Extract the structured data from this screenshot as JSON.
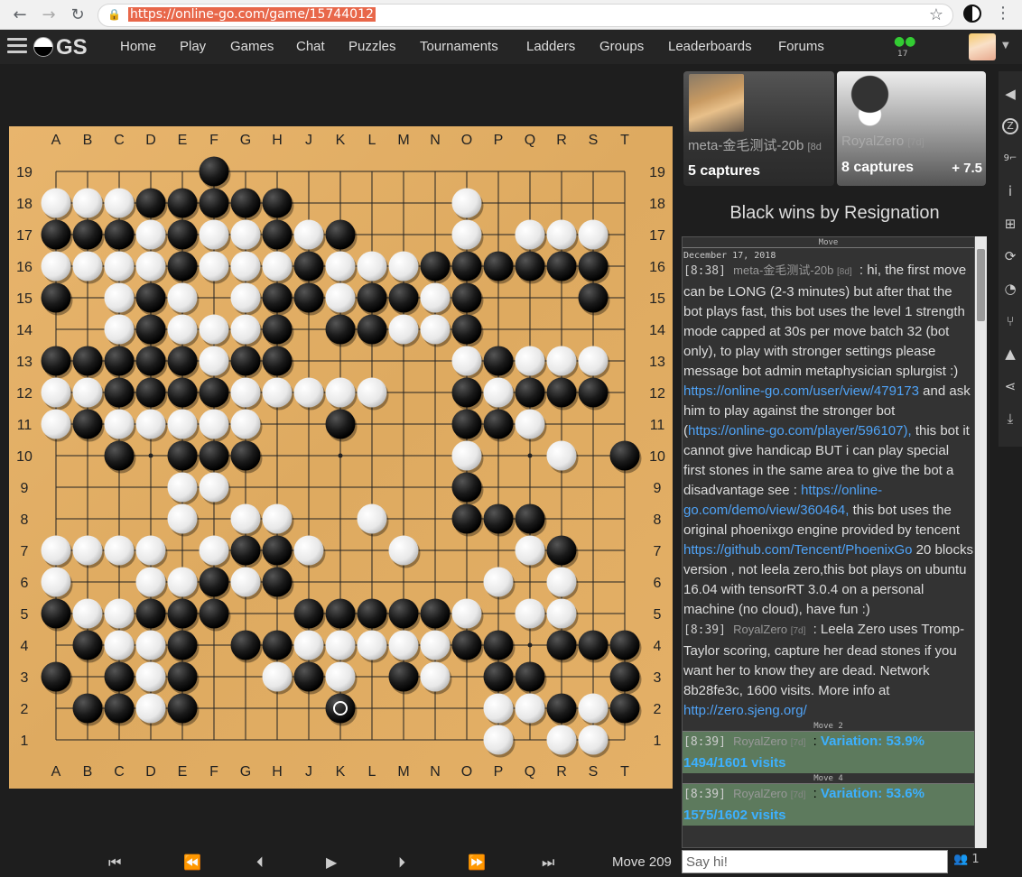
{
  "browser": {
    "url": "https://online-go.com/game/15744012",
    "back": "←",
    "forward": "→",
    "reload": "↻",
    "lock": "🔒",
    "star": "☆",
    "menu": "⋮"
  },
  "site_nav": {
    "logo": "GS",
    "links": [
      "Home",
      "Play",
      "Games",
      "Chat",
      "Puzzles",
      "Tournaments",
      "Ladders",
      "Groups",
      "Leaderboards",
      "Forums"
    ],
    "friends_count": "17"
  },
  "board": {
    "cols": [
      "A",
      "B",
      "C",
      "D",
      "E",
      "F",
      "G",
      "H",
      "J",
      "K",
      "L",
      "M",
      "N",
      "O",
      "P",
      "Q",
      "R",
      "S",
      "T"
    ],
    "rows": [
      "19",
      "18",
      "17",
      "16",
      "15",
      "14",
      "13",
      "12",
      "11",
      "10",
      "9",
      "8",
      "7",
      "6",
      "5",
      "4",
      "3",
      "2",
      "1"
    ],
    "last_move": "K2",
    "grid": [
      ".....B.............",
      "WWWBBBBB.....W.....",
      "BBBWBWWBWB...W.WWW.",
      "WWWWBWWWBWWWBBBBBB.",
      "B.WBW.WBBWBBWB...B.",
      "..WBWWWB.BBWWB.....",
      "BBBBBWBB.....WBWWW.",
      "WWBBBBWWWWW..BWBBB.",
      "WBWWWWW..B...BBW...",
      "..B.BBB......W..W.B",
      "....WW.......B.....",
      "....W.WW..W..BBB...",
      "WWWW.WBBW..W...WB..",
      "W..WWBWB......W.W..",
      "BWWBBB..BBBBBW.WW..",
      ".BWWB.BBWWWWWBB.BBB",
      "B.BWB..WBW.BW.BB..B",
      ".BBWB....B....WWBWBW",
      "..............W.WW.W"
    ]
  },
  "controls": {
    "first": "⏮",
    "prev10": "⏪",
    "prev": "⏴",
    "play": "▶",
    "next": "⏵",
    "next10": "⏩",
    "last": "⏭",
    "move_label": "Move 209"
  },
  "players": {
    "black": {
      "name": "meta-金毛测试-20b",
      "rank": "[8d",
      "captures": "5 captures"
    },
    "white": {
      "name": "RoyalZero",
      "rank": "[7d]",
      "captures": "8 captures",
      "komi": "+ 7.5"
    }
  },
  "result": "Black wins by Resignation",
  "chat": {
    "sep_top": "Move",
    "date": "December 17, 2018",
    "messages": [
      {
        "time": "[8:38]",
        "user": "meta-金毛测试-20b",
        "rank": "[8d]",
        "parts": [
          {
            "t": " : hi, the first move can be LONG (2-3 minutes) but after that the bot plays fast, this bot uses the level 1 strength mode capped at 30s per move batch 32 (bot only), to play with stronger settings please message bot admin metaphysician splurgist :) "
          },
          {
            "l": "https://online-go.com/user/view/479173"
          },
          {
            "t": " and ask him to play against the stronger bot ("
          },
          {
            "l": "https://online-go.com/player/596107),"
          },
          {
            "t": " this bot it cannot give handicap BUT i can play special first stones in the same area to give the bot a disadvantage see : "
          },
          {
            "l": "https://online-go.com/demo/view/360464,"
          },
          {
            "t": " this bot uses the original phoenixgo engine provided by tencent "
          },
          {
            "l": "https://github.com/Tencent/PhoenixGo"
          },
          {
            "t": " 20 blocks version , not leela zero,this bot plays on ubuntu 16.04 with tensorRT 3.0.4 on a personal machine (no cloud), have fun :)"
          }
        ]
      },
      {
        "time": "[8:39]",
        "user": "RoyalZero",
        "rank": "[7d]",
        "parts": [
          {
            "t": " : Leela Zero uses Tromp-Taylor scoring, capture her dead stones if you want her to know they are dead. Network 8b28fe3c, 1600 visits. More info at "
          },
          {
            "l": "http://zero.sjeng.org/"
          }
        ]
      }
    ],
    "variations": [
      {
        "sep": "Move 2",
        "time": "[8:39]",
        "user": "RoyalZero",
        "rank": "[7d]",
        "text": "Variation: 53.9% 1494/1601 visits"
      },
      {
        "sep": "Move 4",
        "time": "[8:39]",
        "user": "RoyalZero",
        "rank": "[7d]",
        "text": "Variation: 53.6% 1575/1602 visits"
      }
    ],
    "input_placeholder": "Say hi!",
    "online_count": "1"
  },
  "dock_icons": [
    "speaker-icon",
    "zen-icon",
    "coordinates-icon",
    "info-icon",
    "tree-icon",
    "rotate-icon",
    "palette-icon",
    "branch-icon",
    "warning-icon",
    "share-icon",
    "download-icon"
  ]
}
